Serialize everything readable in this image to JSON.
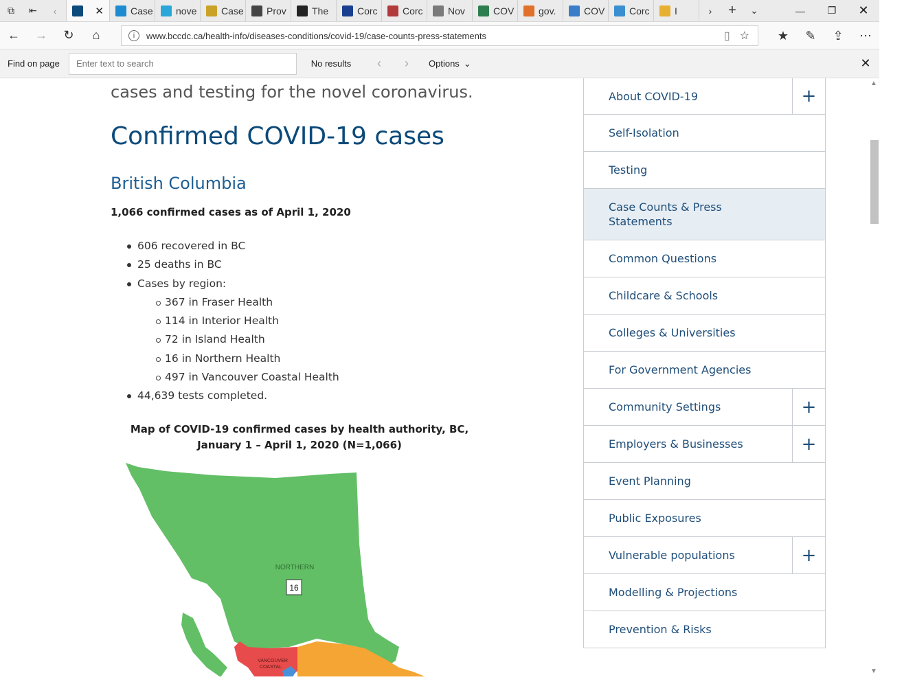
{
  "browser": {
    "tabs": [
      {
        "label": "",
        "color": "#0b4a7a",
        "active": true
      },
      {
        "label": "Case",
        "color": "#1e8bd0"
      },
      {
        "label": "nove",
        "color": "#2aa7d8"
      },
      {
        "label": "Case",
        "color": "#c9a227"
      },
      {
        "label": "Prov",
        "color": "#444444"
      },
      {
        "label": "The",
        "color": "#222222"
      },
      {
        "label": "Corc",
        "color": "#1a3f8f"
      },
      {
        "label": "Corc",
        "color": "#b23a3a"
      },
      {
        "label": "Nov",
        "color": "#7a7a7a"
      },
      {
        "label": "COV",
        "color": "#2e7d4f"
      },
      {
        "label": "gov.",
        "color": "#e0702a"
      },
      {
        "label": "COV",
        "color": "#3a7dc9"
      },
      {
        "label": "Corc",
        "color": "#3a8fd0"
      },
      {
        "label": "I",
        "color": "#e8b030"
      }
    ],
    "url": "www.bccdc.ca/health-info/diseases-conditions/covid-19/case-counts-press-statements",
    "find": {
      "label": "Find on page",
      "placeholder": "Enter text to search",
      "results": "No results",
      "options": "Options"
    }
  },
  "content": {
    "lede": "cases and testing for the novel coronavirus.",
    "title": "Confirmed COVID-19 cases",
    "subtitle": "British Columbia",
    "summary": "1,066 confirmed cases as of April 1, 2020",
    "bullets": [
      {
        "text": "606 recovered in BC",
        "level": 0
      },
      {
        "text": "25 deaths in BC",
        "level": 0
      },
      {
        "text": "Cases by region:",
        "level": 0
      },
      {
        "text": "367 in Fraser Health",
        "level": 1
      },
      {
        "text": "114 in Interior Health",
        "level": 1
      },
      {
        "text": "72 in Island Health",
        "level": 1
      },
      {
        "text": "16 in Northern Health",
        "level": 1
      },
      {
        "text": "497 in Vancouver Coastal Health",
        "level": 1
      },
      {
        "text": "44,639 tests completed.",
        "level": 0
      }
    ],
    "map_title_line1": "Map of COVID-19 confirmed cases by health authority, BC,",
    "map_title_line2": "January 1 – April 1, 2020 (N=1,066)",
    "map": {
      "northern_label": "NORTHERN",
      "northern_count": "16",
      "vancouver_label_1": "VANCOUVER",
      "vancouver_label_2": "COASTAL",
      "colors": {
        "northern": "#62bf66",
        "vancouver_coastal": "#e84b4b",
        "interior": "#f5a533",
        "island": "#4a90d9"
      }
    }
  },
  "sidebar": {
    "items": [
      {
        "label": "About COVID-19",
        "expandable": true
      },
      {
        "label": "Self-Isolation"
      },
      {
        "label": "Testing"
      },
      {
        "label": "Case Counts & Press Statements",
        "active": true
      },
      {
        "label": "Common Questions"
      },
      {
        "label": "Childcare & Schools"
      },
      {
        "label": "Colleges & Universities"
      },
      {
        "label": "For Government Agencies"
      },
      {
        "label": "Community Settings",
        "expandable": true
      },
      {
        "label": "Employers & Businesses",
        "expandable": true
      },
      {
        "label": "Event Planning"
      },
      {
        "label": "Public Exposures"
      },
      {
        "label": "Vulnerable populations",
        "expandable": true
      },
      {
        "label": "Modelling & Projections"
      },
      {
        "label": "Prevention & Risks"
      }
    ],
    "plus_glyph": "+"
  }
}
